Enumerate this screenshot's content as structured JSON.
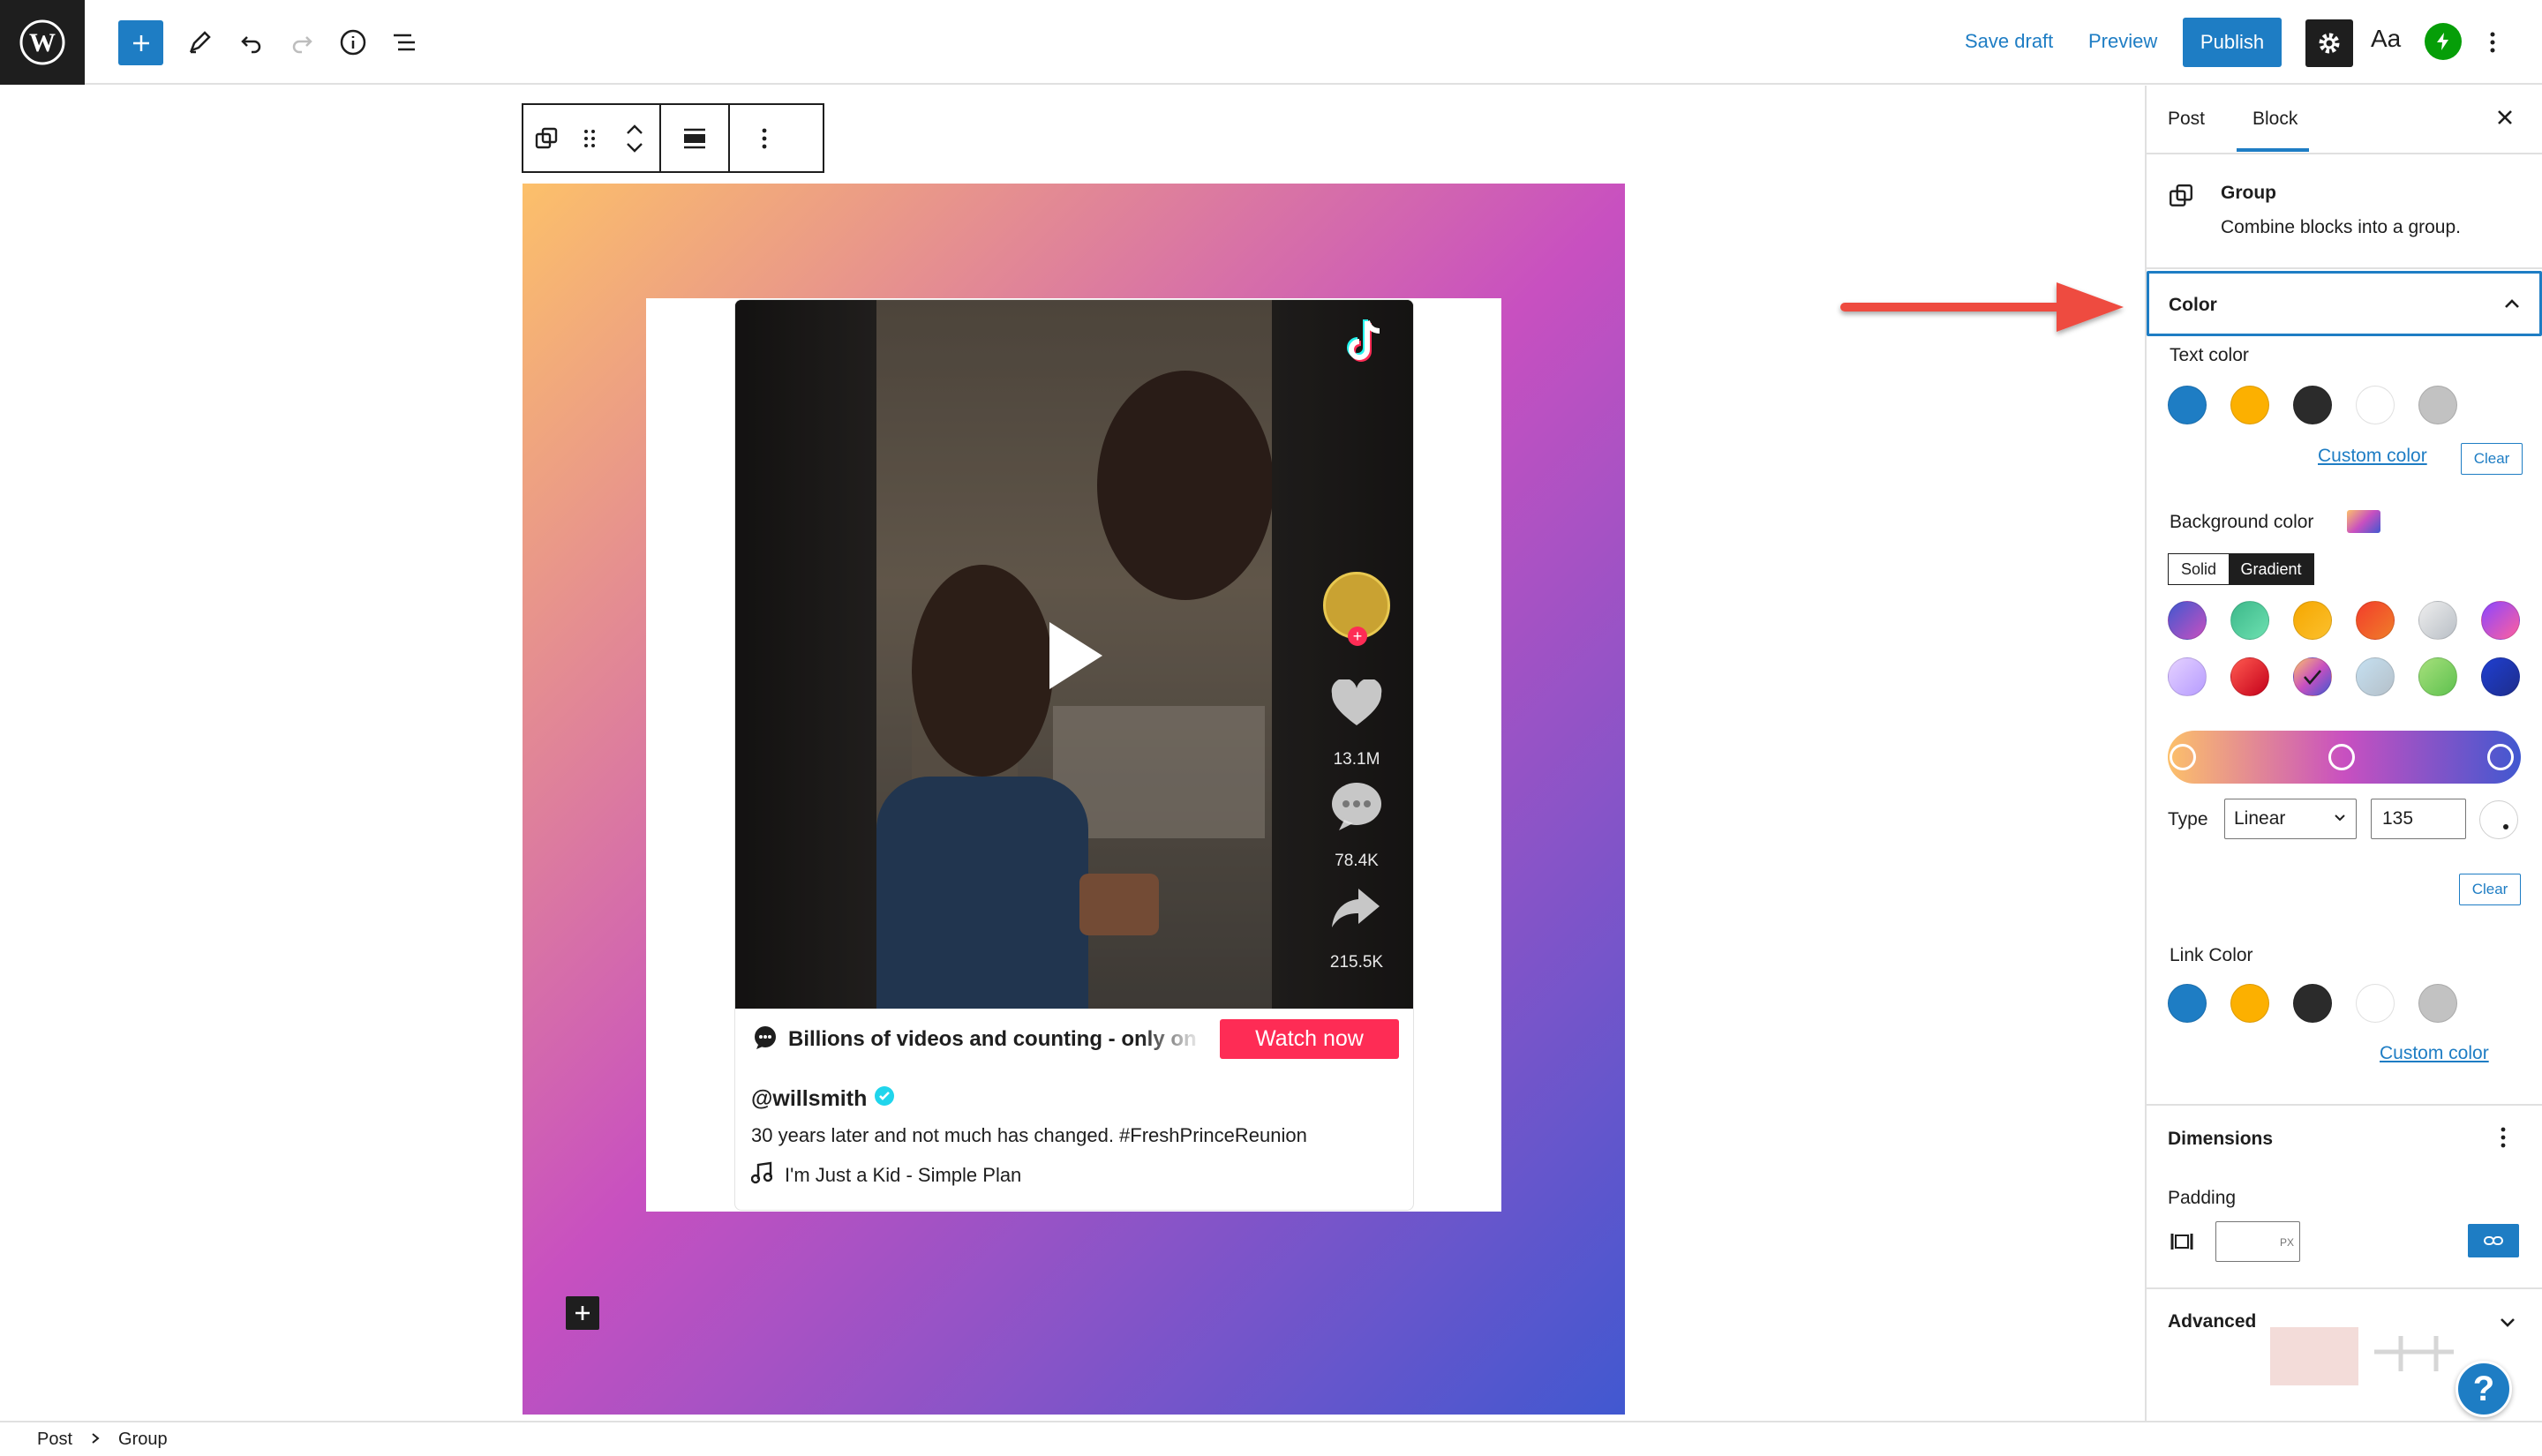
{
  "toolbar": {
    "save_draft": "Save draft",
    "preview": "Preview",
    "publish": "Publish",
    "typography_label": "Aa"
  },
  "embed": {
    "tagline": "Billions of videos and counting - only on T",
    "watch_now": "Watch now",
    "username": "@willsmith",
    "caption": "30 years later and not much has changed. #FreshPrinceReunion",
    "music": "I'm Just a Kid - Simple Plan",
    "likes": "13.1M",
    "comments": "78.4K",
    "shares": "215.5K"
  },
  "sidebar": {
    "tabs": [
      "Post",
      "Block"
    ],
    "active_tab": "Block",
    "block_name": "Group",
    "block_desc": "Combine blocks into a group.",
    "color_panel": "Color",
    "text_color_label": "Text color",
    "custom_color": "Custom color",
    "clear": "Clear",
    "bg_color_label": "Background color",
    "solid": "Solid",
    "gradient": "Gradient",
    "type_label": "Type",
    "type_value": "Linear",
    "angle": "135",
    "link_color_label": "Link Color",
    "dimensions": "Dimensions",
    "padding": "Padding",
    "padding_unit": "PX",
    "advanced": "Advanced",
    "help": "?"
  },
  "colors": {
    "text_swatches": [
      "#1e7dc4",
      "#fcb000",
      "#2b2b2b",
      "#ffffff",
      "#c2c2c2"
    ],
    "gradient_swatches": [
      "linear-gradient(135deg,#4158d0,#c850c0)",
      "linear-gradient(135deg,#3cb88a,#6de0b0)",
      "linear-gradient(135deg,#f6a700,#fbc02d)",
      "linear-gradient(135deg,#f23d2b,#f07d29)",
      "linear-gradient(135deg,#eeeeee,#b9bfc6)",
      "linear-gradient(135deg,#8b46ff,#ff5f9e)",
      "linear-gradient(135deg,#e5d1ff,#b69cff)",
      "linear-gradient(135deg,#ff5a50,#c4001a)",
      "linear-gradient(135deg,#fcc06a,#c850c0,#4158d0)",
      "linear-gradient(135deg,#c5e0f1,#b5c0c9)",
      "linear-gradient(135deg,#a6e07c,#5ec14e)",
      "linear-gradient(135deg,#1f3fd1,#1e2d8c)"
    ],
    "link_swatches": [
      "#1e7dc4",
      "#fcb000",
      "#2b2b2b",
      "#ffffff",
      "#c2c2c2"
    ],
    "accent": "#1e7dc4",
    "tiktok_red": "#fe2c55"
  },
  "breadcrumb": [
    "Post",
    "Group"
  ]
}
